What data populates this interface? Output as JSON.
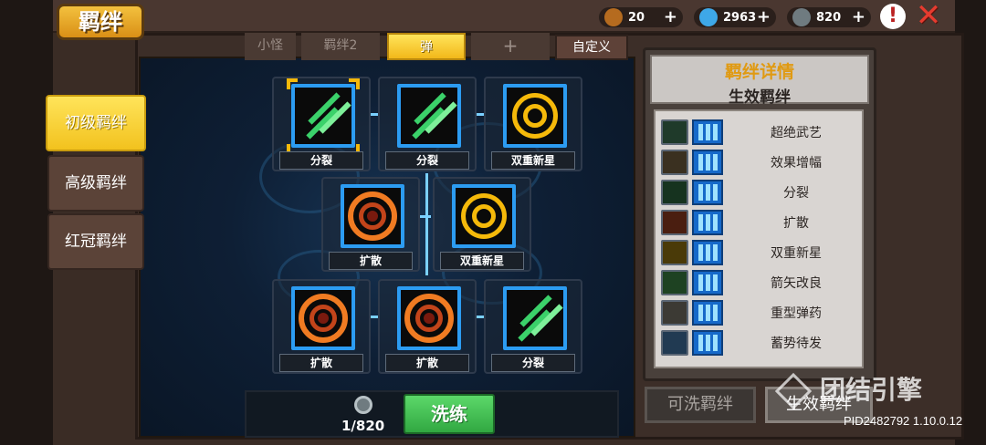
{
  "title": "羁绊",
  "currencies": [
    {
      "name": "gold",
      "icon": "fist-coin-icon",
      "value": "20"
    },
    {
      "name": "gems",
      "icon": "blue-gem-icon",
      "value": "2963"
    },
    {
      "name": "parts",
      "icon": "gear-coin-icon",
      "value": "820"
    }
  ],
  "plus_symbol": "+",
  "warn_symbol": "!",
  "close_symbol": "✕",
  "side_tabs": [
    {
      "label": "初级羁绊",
      "active": true
    },
    {
      "label": "高级羁绊",
      "active": false
    },
    {
      "label": "红冠羁绊",
      "active": false
    }
  ],
  "top_tabs": [
    {
      "label": "小怪",
      "active": false
    },
    {
      "label": "羁绊2",
      "active": false
    },
    {
      "label": "弹",
      "active": true
    },
    {
      "label": "+",
      "active": false
    }
  ],
  "custom_label": "自定义",
  "grid": [
    {
      "label": "分裂",
      "icon": "split-arrows-icon",
      "selected": true
    },
    {
      "label": "分裂",
      "icon": "split-arrows-icon",
      "selected": false
    },
    {
      "label": "双重新星",
      "icon": "double-nova-icon",
      "selected": false
    },
    {
      "label": "扩散",
      "icon": "spread-ring-icon",
      "selected": false
    },
    {
      "label": "双重新星",
      "icon": "double-nova-icon",
      "selected": false
    },
    {
      "label": "扩散",
      "icon": "spread-ring-icon",
      "selected": false
    },
    {
      "label": "扩散",
      "icon": "spread-ring-icon",
      "selected": false
    },
    {
      "label": "分裂",
      "icon": "split-arrows-icon",
      "selected": false
    }
  ],
  "coins": {
    "count": "1/820",
    "icon": "gear-coin-icon"
  },
  "refine_label": "洗练",
  "detail": {
    "title": "羁绊详情",
    "subtitle": "生效羁绊",
    "bonds": [
      {
        "name": "超绝武艺",
        "icon": "martial-arts-icon"
      },
      {
        "name": "效果增幅",
        "icon": "amplify-icon"
      },
      {
        "name": "分裂",
        "icon": "split-arrows-icon"
      },
      {
        "name": "扩散",
        "icon": "spread-ring-icon"
      },
      {
        "name": "双重新星",
        "icon": "double-nova-icon"
      },
      {
        "name": "箭矢改良",
        "icon": "arrow-upgrade-icon"
      },
      {
        "name": "重型弹药",
        "icon": "heavy-ammo-icon"
      },
      {
        "name": "蓄势待发",
        "icon": "charge-ready-icon"
      }
    ]
  },
  "washable_label": "可洗羁绊",
  "effective_label": "生效羁绊",
  "watermark": "团结引擎",
  "version": "PID2482792 1.10.0.12",
  "colors": {
    "accent": "#f2c21e",
    "frame_blue": "#2c9cf2",
    "green": "#3bd16a",
    "orange": "#f07b22",
    "gold": "#f5b90a"
  }
}
